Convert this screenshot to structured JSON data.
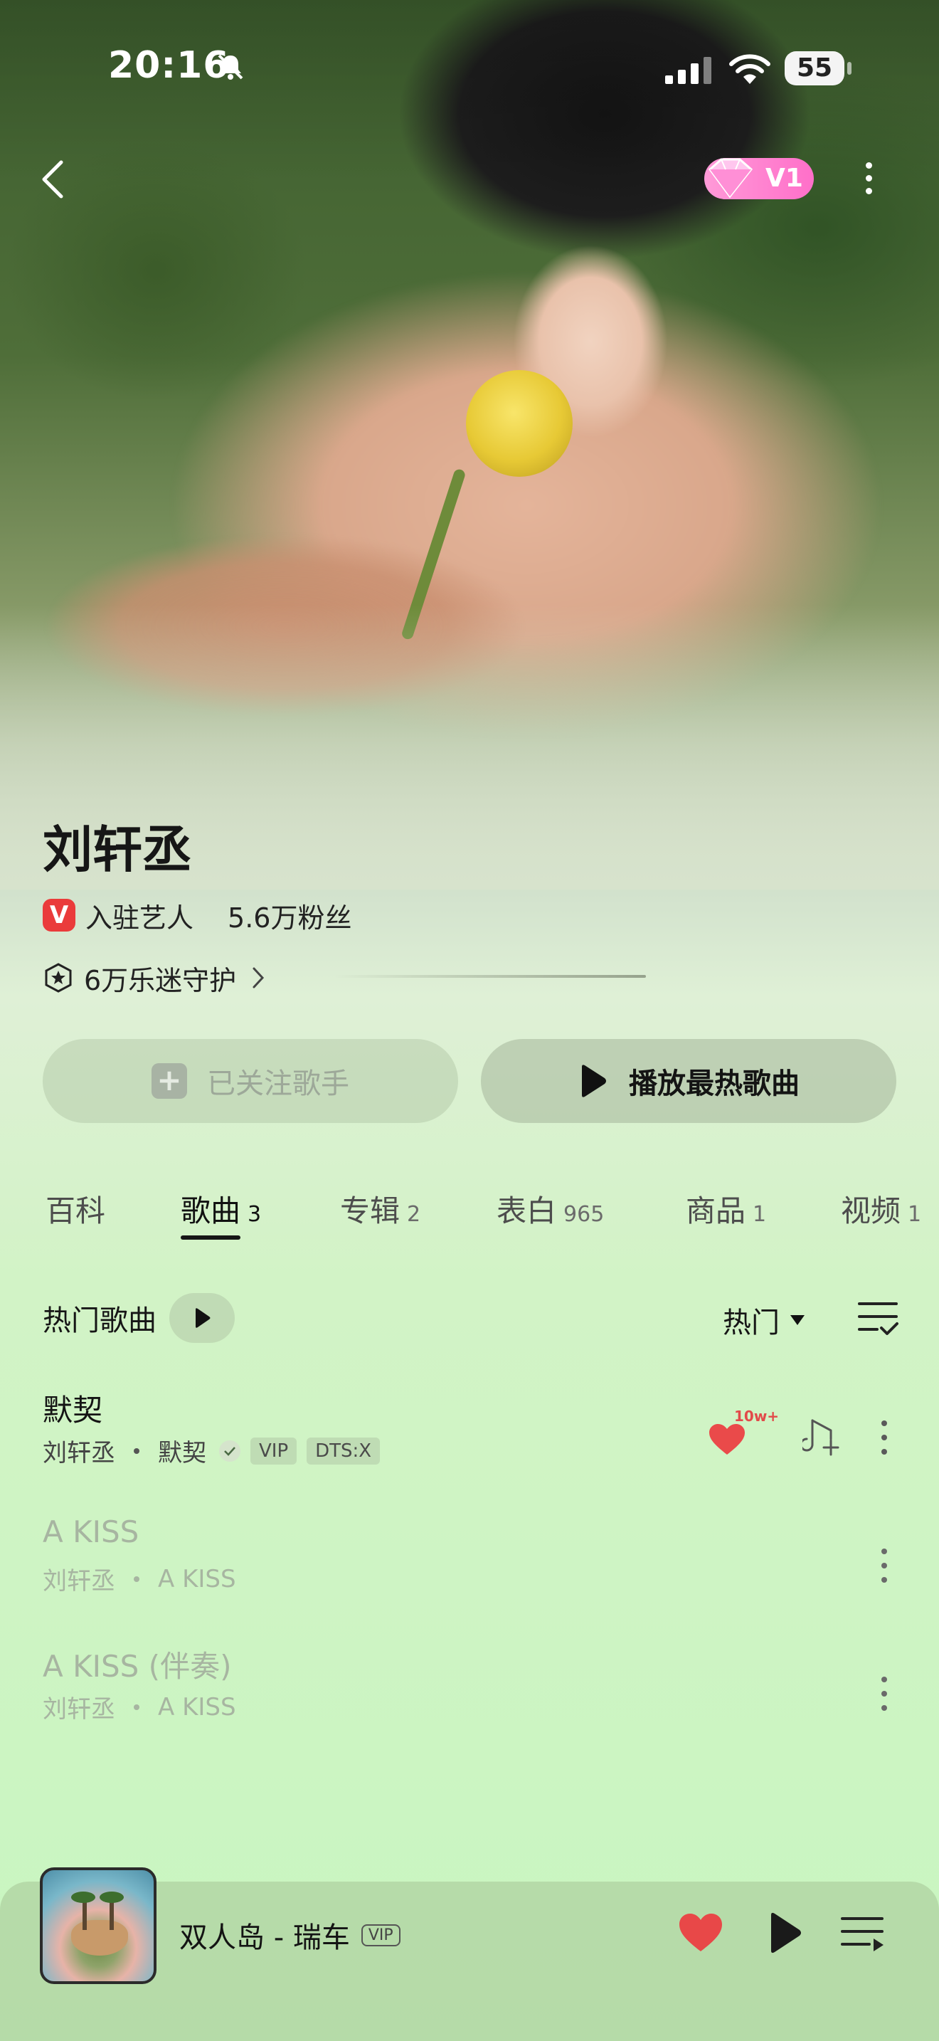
{
  "status_bar": {
    "time": "20:16",
    "battery": "55"
  },
  "header": {
    "vip_level": "V1"
  },
  "artist": {
    "name": "刘轩丞",
    "badge": "V",
    "verified_label": "入驻艺人",
    "fans": "5.6万粉丝",
    "guard": "6万乐迷守护"
  },
  "actions": {
    "followed_label": "已关注歌手",
    "play_hot_label": "播放最热歌曲"
  },
  "tabs": [
    {
      "label": "百科",
      "count": ""
    },
    {
      "label": "歌曲",
      "count": "3"
    },
    {
      "label": "专辑",
      "count": "2"
    },
    {
      "label": "表白",
      "count": "965"
    },
    {
      "label": "商品",
      "count": "1"
    },
    {
      "label": "视频",
      "count": "1"
    }
  ],
  "list_header": {
    "title": "热门歌曲",
    "sort_label": "热门"
  },
  "songs": [
    {
      "title": "默契",
      "artist": "刘轩丞",
      "album": "默契",
      "tags": [
        "VIP",
        "DTS:X"
      ],
      "like_count": "10w+"
    },
    {
      "title": "A KISS",
      "artist": "刘轩丞",
      "album": "A KISS"
    },
    {
      "title": "A KISS (伴奏)",
      "artist": "刘轩丞",
      "album": "A KISS"
    }
  ],
  "player": {
    "now_playing": "双人岛 - 瑞车",
    "vip_tag": "VIP"
  },
  "colors": {
    "accent_red": "#ea3b3b",
    "heart": "#e84848",
    "vip_pink": "#ff6fc9"
  }
}
